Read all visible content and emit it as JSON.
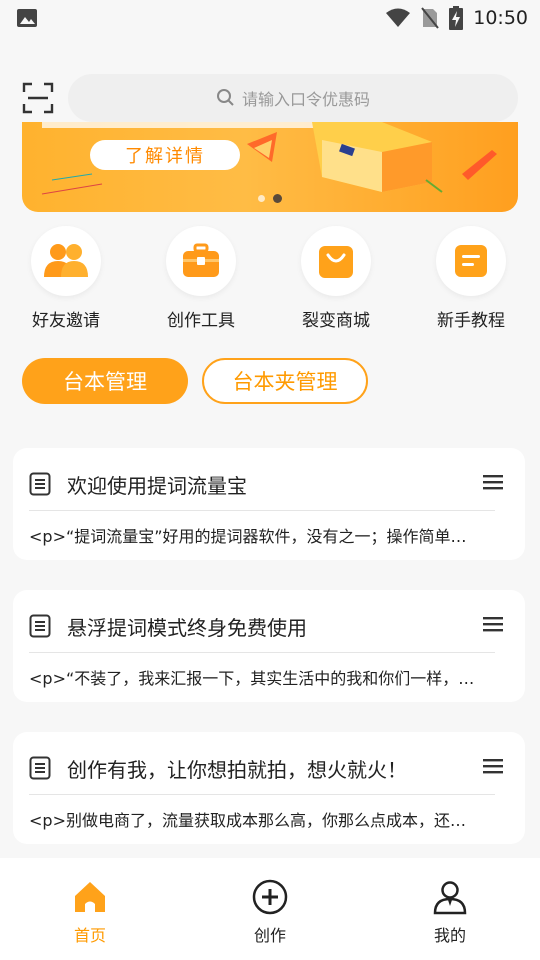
{
  "status": {
    "time": "10:50"
  },
  "search": {
    "placeholder": "请输入口令优惠码"
  },
  "banner": {
    "cta": "了解详情",
    "slide_index": 2,
    "slide_count": 2
  },
  "quick": [
    {
      "label": "好友邀请",
      "icon": "group-icon"
    },
    {
      "label": "创作工具",
      "icon": "briefcase-icon"
    },
    {
      "label": "裂变商城",
      "icon": "shopping-bag-icon"
    },
    {
      "label": "新手教程",
      "icon": "note-icon"
    }
  ],
  "tabs": {
    "active": "台本管理",
    "inactive": "台本夹管理"
  },
  "cards": [
    {
      "title": "欢迎使用提词流量宝",
      "snippet": "<p>“提词流量宝”好用的提词器软件，没有之一；操作简单…"
    },
    {
      "title": "悬浮提词模式终身免费使用",
      "snippet": "<p>“不装了，我来汇报一下，其实生活中的我和你们一样，…"
    },
    {
      "title": "创作有我，让你想拍就拍，想火就火！",
      "snippet": "<p>别做电商了，流量获取成本那么高，你那么点成本，还…"
    }
  ],
  "nav": {
    "home": "首页",
    "create": "创作",
    "mine": "我的"
  },
  "colors": {
    "accent": "#ffa21a",
    "active_text": "#ff9a00"
  }
}
